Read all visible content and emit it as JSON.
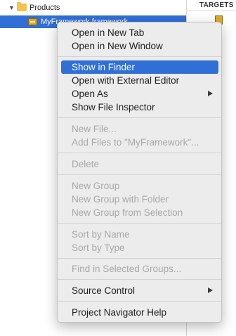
{
  "navigator": {
    "products_label": "Products",
    "framework_label": "MyFramework.framework"
  },
  "targets": {
    "header": "TARGETS"
  },
  "context_menu": {
    "items": [
      {
        "label": "Open in New Tab",
        "enabled": true
      },
      {
        "label": "Open in New Window",
        "enabled": true
      },
      {
        "label": "Show in Finder",
        "enabled": true,
        "highlighted": true
      },
      {
        "label": "Open with External Editor",
        "enabled": true
      },
      {
        "label": "Open As",
        "enabled": true,
        "submenu": true
      },
      {
        "label": "Show File Inspector",
        "enabled": true
      },
      {
        "label": "New File...",
        "enabled": false
      },
      {
        "label": "Add Files to \"MyFramework\"...",
        "enabled": false
      },
      {
        "label": "Delete",
        "enabled": false
      },
      {
        "label": "New Group",
        "enabled": false
      },
      {
        "label": "New Group with Folder",
        "enabled": false
      },
      {
        "label": "New Group from Selection",
        "enabled": false
      },
      {
        "label": "Sort by Name",
        "enabled": false
      },
      {
        "label": "Sort by Type",
        "enabled": false
      },
      {
        "label": "Find in Selected Groups...",
        "enabled": false
      },
      {
        "label": "Source Control",
        "enabled": true,
        "submenu": true
      },
      {
        "label": "Project Navigator Help",
        "enabled": true
      }
    ]
  },
  "colors": {
    "selection": "#2f6fd6",
    "menu_background": "#ececec",
    "disabled_text": "#a8a8a8"
  }
}
